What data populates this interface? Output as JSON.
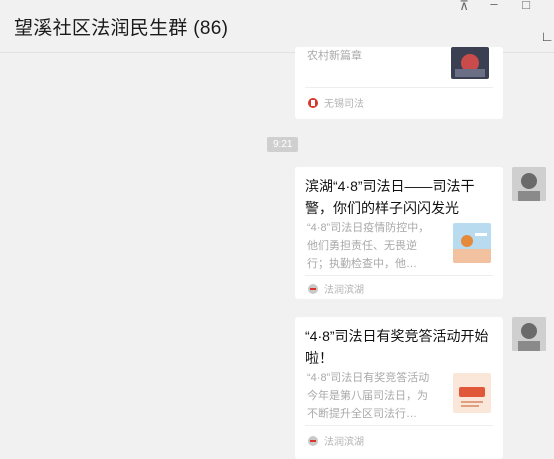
{
  "window": {
    "title": "望溪社区法润民生群 (86)",
    "pin_icon": "⊼",
    "minimize_icon": "–",
    "maximize_icon": "□",
    "edge_mark": "∟"
  },
  "timestamp": "9:21",
  "messages": [
    {
      "kind": "article-partial",
      "desc": "农村新篇章",
      "source": "无锡司法",
      "source_icon": "red-badge-icon"
    },
    {
      "kind": "article",
      "title": "滨湖“4·8”司法日——司法干警，你们的样子闪闪发光",
      "desc": "“4·8”司法日疫情防控中，他们勇担责任、无畏逆行；执勤检查中，他…",
      "source": "法润滨湖",
      "source_icon": "gavel-icon"
    },
    {
      "kind": "article",
      "title": "“4·8”司法日有奖竞答活动开始啦！",
      "desc": "“4·8”司法日有奖竞答活动今年是第八届司法日，为不断提升全区司法行…",
      "source": "法润滨湖",
      "source_icon": "gavel-icon"
    }
  ],
  "colors": {
    "background": "#f1f1f1",
    "card": "#ffffff",
    "muted_text": "#a9a9a9",
    "source_red": "#d9352b"
  }
}
